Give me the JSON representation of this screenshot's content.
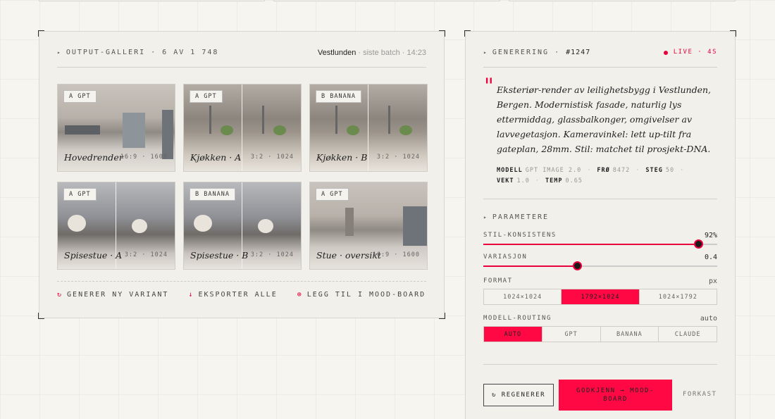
{
  "gallery": {
    "title": "OUTPUT-GALLERI · 6 AV 1 748",
    "project": "Vestlunden",
    "batch": " · siste batch · 14:23",
    "tiles": [
      {
        "tag": "A GPT",
        "caption": "Hovedrender",
        "dims": "16:9 · 1600"
      },
      {
        "tag": "A GPT",
        "caption": "Kjøkken · A",
        "dims": "3:2 · 1024"
      },
      {
        "tag": "B BANANA",
        "caption": "Kjøkken · B",
        "dims": "3:2 · 1024"
      },
      {
        "tag": "A GPT",
        "caption": "Spisestue · A",
        "dims": "3:2 · 1024"
      },
      {
        "tag": "B BANANA",
        "caption": "Spisestue · B",
        "dims": "3:2 · 1024"
      },
      {
        "tag": "A GPT",
        "caption": "Stue · oversikt",
        "dims": "16:9 · 1600"
      }
    ],
    "actions": {
      "generate": "GENERER NY VARIANT",
      "export": "EKSPORTER ALLE",
      "moodboard": "LEGG TIL I MOOD-BOARD"
    },
    "icons": {
      "generate": "↻",
      "export": "↓",
      "moodboard": "⊕"
    }
  },
  "generation": {
    "title": "GENERERING",
    "id": "#1247",
    "live": "LIVE · 4S",
    "prompt": "Eksteriør-render av leilighetsbygg i Vestlunden, Bergen. Modernistisk fasade, naturlig lys ettermiddag, glassbalkonger, omgivelser av lavvegetasjon. Kameravinkel: lett up-tilt fra gateplan, 28mm. Stil: matchet til prosjekt-DNA.",
    "meta": {
      "model_label": "MODELL",
      "model": "GPT IMAGE 2.0",
      "seed_label": "FRØ",
      "seed": "8472",
      "steps_label": "STEG",
      "steps": "50",
      "weight_label": "VEKT",
      "weight": "1.0",
      "temp_label": "TEMP",
      "temp": "0.65"
    },
    "params_title": "PARAMETERE",
    "style_consistency": {
      "label": "STIL-KONSISTENS",
      "value": "92%",
      "fraction": 0.92
    },
    "variation": {
      "label": "VARIASJON",
      "value": "0.4",
      "fraction": 0.4
    },
    "format": {
      "label": "FORMAT",
      "unit": "px",
      "options": [
        "1024×1024",
        "1792×1024",
        "1024×1792"
      ],
      "selected": 1
    },
    "routing": {
      "label": "MODELL-ROUTING",
      "value": "auto",
      "options": [
        "AUTO",
        "GPT",
        "BANANA",
        "CLAUDE"
      ],
      "selected": 0
    },
    "buttons": {
      "regenerate": "↻ REGENERER",
      "approve": "GODKJENN → MOOD-BOARD",
      "discard": "FORKAST"
    }
  },
  "colors": {
    "accent": "#ff0844",
    "live": "#e8003c"
  }
}
